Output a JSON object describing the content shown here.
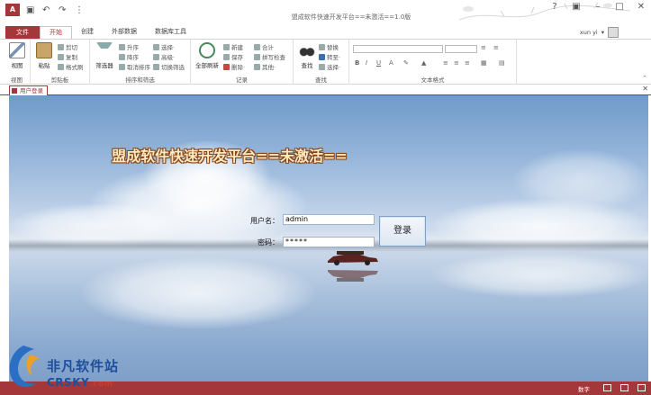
{
  "window": {
    "title": "盟成软件快速开发平台==未激活==1.0版",
    "logo_text": "A",
    "user": "xun yi"
  },
  "tabs": [
    "文件",
    "开始",
    "创建",
    "外部数据",
    "数据库工具"
  ],
  "ribbon": {
    "groups": [
      "视图",
      "剪贴板",
      "排序和筛选",
      "记录",
      "查找",
      "文本格式"
    ],
    "view": {
      "label": "视图"
    },
    "clipboard": {
      "paste": "粘贴",
      "cut": "剪切",
      "copy": "复制",
      "format_painter": "格式刷"
    },
    "sort_filter": {
      "filter": "筛选器",
      "ascending": "升序",
      "descending": "降序",
      "remove_sort": "取消排序",
      "selection": "选择·",
      "advanced": "高级·",
      "toggle_filter": "切换筛选"
    },
    "records": {
      "refresh_all": "全部刷新",
      "new": "新建",
      "save": "保存",
      "delete": "删除·",
      "totals": "合计",
      "spelling": "拼写检查",
      "more": "其他·"
    },
    "find": {
      "find": "查找",
      "replace": "替换",
      "goto": "转至·",
      "select": "选择·"
    },
    "text_format": {
      "bold": "B",
      "italic": "I",
      "underline": "U"
    }
  },
  "document_tab": "用户登录",
  "form": {
    "title": "盟成软件快速开发平台==未激活==",
    "username_label": "用户名：",
    "username_value": "admin",
    "password_label": "密码：",
    "password_value": "*****",
    "login_button": "登录"
  },
  "statusbar": {
    "mode": "数字"
  },
  "watermark": {
    "cn": "非凡软件站",
    "en": "CRSKY",
    "suffix": ".com"
  }
}
